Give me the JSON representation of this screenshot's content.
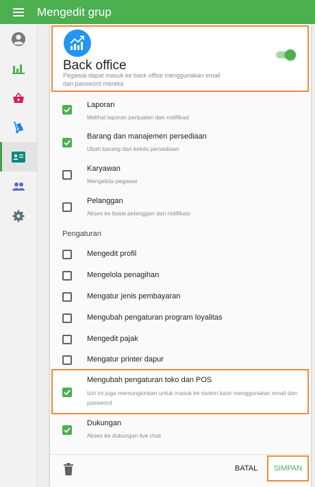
{
  "appbar": {
    "title": "Mengedit grup"
  },
  "colors": {
    "primary": "#4caf50",
    "highlight": "#f08a3c",
    "bo_icon": "#2196f3"
  },
  "sidebar": {
    "items": [
      {
        "icon": "account-circle-icon",
        "active": false
      },
      {
        "icon": "bar-chart-icon",
        "active": false
      },
      {
        "icon": "basket-icon",
        "active": false
      },
      {
        "icon": "dolly-icon",
        "active": false
      },
      {
        "icon": "id-card-icon",
        "active": true
      },
      {
        "icon": "people-icon",
        "active": false
      },
      {
        "icon": "gear-icon",
        "active": false
      }
    ]
  },
  "back_office": {
    "title": "Back office",
    "description": "Pegawai dapat masuk ke back office menggunakan email dan password mereka",
    "enabled": true
  },
  "permissions": [
    {
      "label": "Laporan",
      "description": "Melihat laporan penjualan dan notifikasi",
      "checked": true
    },
    {
      "label": "Barang dan manajemen persediaan",
      "description": "Ubah barang dan kelola persediaan",
      "checked": true
    },
    {
      "label": "Karyawan",
      "description": "Mengelola pegawai",
      "checked": false
    },
    {
      "label": "Pelanggan",
      "description": "Akses ke basis pelanggan dan notifikasi",
      "checked": false
    }
  ],
  "settings_section": {
    "label": "Pengaturan",
    "items": [
      {
        "label": "Mengedit profil",
        "checked": false
      },
      {
        "label": "Mengelola penagihan",
        "checked": false
      },
      {
        "label": "Mengatur jenis pembayaran",
        "checked": false
      },
      {
        "label": "Mengubah pengaturan program loyalitas",
        "checked": false
      },
      {
        "label": "Mengedit pajak",
        "checked": false
      },
      {
        "label": "Mengatur printer dapur",
        "checked": false
      }
    ]
  },
  "pos_settings": {
    "label": "Mengubah pengaturan toko dan POS",
    "description": "Izin ini juga memungkinkan untuk masuk ke sistem kasir menggunakan email dan password",
    "checked": true
  },
  "support": {
    "label": "Dukungan",
    "description": "Akses ke dukungan live chat",
    "checked": true
  },
  "footer": {
    "cancel_label": "BATAL",
    "save_label": "SIMPAN"
  }
}
